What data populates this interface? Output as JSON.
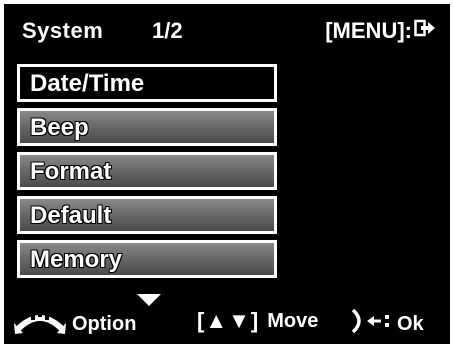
{
  "header": {
    "title": "System",
    "page": "1/2",
    "menu_key": "[MENU]:"
  },
  "menu": {
    "items": [
      {
        "label": "Date/Time",
        "selected": true
      },
      {
        "label": "Beep",
        "selected": false
      },
      {
        "label": "Format",
        "selected": false
      },
      {
        "label": "Default",
        "selected": false
      },
      {
        "label": "Memory",
        "selected": false
      }
    ]
  },
  "footer": {
    "option_label": "Option",
    "move_keys": "[▲▼]",
    "move_label": "Move",
    "ok_label": "Ok"
  },
  "icons": {
    "exit": "exit-icon",
    "more_below": "chevron-down-icon",
    "option": "dial-icon",
    "ok": "shutter-release-icon"
  }
}
